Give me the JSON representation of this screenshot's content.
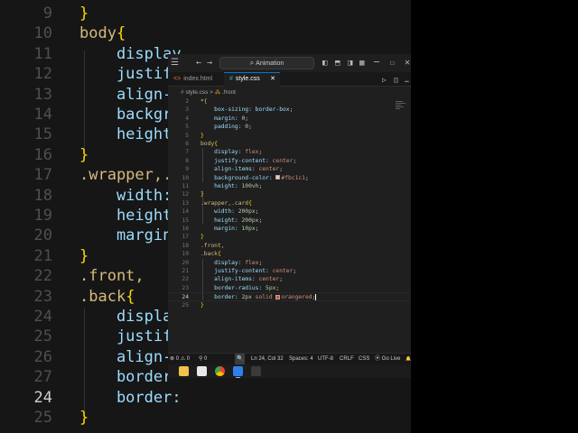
{
  "background_editor": {
    "lines": [
      {
        "num": "9",
        "code": [
          {
            "t": "}",
            "c": "brace"
          }
        ],
        "active": false
      },
      {
        "num": "10",
        "code": [
          {
            "t": "body",
            "c": "sel"
          },
          {
            "t": "{",
            "c": "brace"
          }
        ],
        "active": false
      },
      {
        "num": "11",
        "code": [
          {
            "t": "    display",
            "c": "prop"
          }
        ],
        "active": false
      },
      {
        "num": "12",
        "code": [
          {
            "t": "    justify",
            "c": "prop"
          }
        ],
        "active": false
      },
      {
        "num": "13",
        "code": [
          {
            "t": "    align-i",
            "c": "prop"
          }
        ],
        "active": false
      },
      {
        "num": "14",
        "code": [
          {
            "t": "    backgro",
            "c": "prop"
          }
        ],
        "active": false
      },
      {
        "num": "15",
        "code": [
          {
            "t": "    height:",
            "c": "prop"
          }
        ],
        "active": false
      },
      {
        "num": "16",
        "code": [
          {
            "t": "}",
            "c": "brace"
          }
        ],
        "active": false
      },
      {
        "num": "17",
        "code": [
          {
            "t": ".wrapper,.c",
            "c": "sel"
          }
        ],
        "active": false
      },
      {
        "num": "18",
        "code": [
          {
            "t": "    width:",
            "c": "prop"
          }
        ],
        "active": false
      },
      {
        "num": "19",
        "code": [
          {
            "t": "    height:",
            "c": "prop"
          }
        ],
        "active": false
      },
      {
        "num": "20",
        "code": [
          {
            "t": "    margin:",
            "c": "prop"
          }
        ],
        "active": false
      },
      {
        "num": "21",
        "code": [
          {
            "t": "}",
            "c": "brace"
          }
        ],
        "active": false
      },
      {
        "num": "22",
        "code": [
          {
            "t": ".front,",
            "c": "sel"
          }
        ],
        "active": false
      },
      {
        "num": "23",
        "code": [
          {
            "t": ".back",
            "c": "sel"
          },
          {
            "t": "{",
            "c": "brace"
          }
        ],
        "active": false
      },
      {
        "num": "24",
        "code": [
          {
            "t": "    display",
            "c": "prop"
          }
        ],
        "active": false
      },
      {
        "num": "25",
        "code": [
          {
            "t": "    justify",
            "c": "prop"
          }
        ],
        "active": false
      },
      {
        "num": "26",
        "code": [
          {
            "t": "    align-i",
            "c": "prop"
          }
        ],
        "active": false
      },
      {
        "num": "27",
        "code": [
          {
            "t": "    border-",
            "c": "prop"
          }
        ],
        "active": false
      },
      {
        "num": "24",
        "code": [
          {
            "t": "    border:",
            "c": "prop"
          }
        ],
        "active": true
      },
      {
        "num": "25",
        "code": [
          {
            "t": "}",
            "c": "brace"
          }
        ],
        "active": false
      }
    ]
  },
  "titlebar": {
    "search_text": "Animation",
    "icons": [
      "menu-icon",
      "back-arrow-icon",
      "forward-arrow-icon",
      "layout-sidebar-icon",
      "layout-panel-icon",
      "layout-split-icon",
      "customize-layout-icon",
      "minimize-icon",
      "maximize-icon",
      "close-icon"
    ]
  },
  "tabs": [
    {
      "label": "index.html",
      "icon": "<>",
      "active": false
    },
    {
      "label": "style.css",
      "icon": "#",
      "active": true,
      "close": "✕"
    }
  ],
  "breadcrumb": {
    "file": "style.css",
    "separator": ">",
    "symbol": ".front"
  },
  "code_lines": [
    {
      "num": "2",
      "segs": [
        {
          "t": "*{",
          "c": "sel"
        }
      ]
    },
    {
      "num": "3",
      "segs": [
        {
          "t": "    box-sizing: border-box;",
          "c": "prop"
        }
      ]
    },
    {
      "num": "4",
      "segs": [
        {
          "t": "    margin: ",
          "c": "prop"
        },
        {
          "t": "0",
          "c": "num"
        },
        {
          "t": ";",
          "c": "punc"
        }
      ]
    },
    {
      "num": "5",
      "segs": [
        {
          "t": "    padding: ",
          "c": "prop"
        },
        {
          "t": "0",
          "c": "num"
        },
        {
          "t": ";",
          "c": "punc"
        }
      ]
    },
    {
      "num": "5",
      "segs": [
        {
          "t": "}",
          "c": "brace"
        }
      ]
    },
    {
      "num": "6",
      "segs": [
        {
          "t": "body",
          "c": "sel"
        },
        {
          "t": "{",
          "c": "brace"
        }
      ]
    },
    {
      "num": "7",
      "segs": [
        {
          "t": "    display: ",
          "c": "prop"
        },
        {
          "t": "flex",
          "c": "val"
        },
        {
          "t": ";",
          "c": "punc"
        }
      ]
    },
    {
      "num": "8",
      "segs": [
        {
          "t": "    justify-content: ",
          "c": "prop"
        },
        {
          "t": "center",
          "c": "val"
        },
        {
          "t": ";",
          "c": "punc"
        }
      ]
    },
    {
      "num": "9",
      "segs": [
        {
          "t": "    align-items: ",
          "c": "prop"
        },
        {
          "t": "center",
          "c": "val"
        },
        {
          "t": ";",
          "c": "punc"
        }
      ]
    },
    {
      "num": "10",
      "segs": [
        {
          "t": "    background-color: ",
          "c": "prop"
        },
        {
          "swatch": "#fbc1c1"
        },
        {
          "t": "#fbc1c1",
          "c": "val"
        },
        {
          "t": ";",
          "c": "punc"
        }
      ]
    },
    {
      "num": "11",
      "segs": [
        {
          "t": "    height: ",
          "c": "prop"
        },
        {
          "t": "100vh",
          "c": "num"
        },
        {
          "t": ";",
          "c": "punc"
        }
      ]
    },
    {
      "num": "12",
      "segs": [
        {
          "t": "}",
          "c": "brace"
        }
      ]
    },
    {
      "num": "13",
      "segs": [
        {
          "t": ".wrapper,.card",
          "c": "sel"
        },
        {
          "t": "{",
          "c": "brace"
        }
      ]
    },
    {
      "num": "14",
      "segs": [
        {
          "t": "    width: ",
          "c": "prop"
        },
        {
          "t": "200px",
          "c": "num"
        },
        {
          "t": ";",
          "c": "punc"
        }
      ]
    },
    {
      "num": "15",
      "segs": [
        {
          "t": "    height: ",
          "c": "prop"
        },
        {
          "t": "200px",
          "c": "num"
        },
        {
          "t": ";",
          "c": "punc"
        }
      ]
    },
    {
      "num": "16",
      "segs": [
        {
          "t": "    margin: ",
          "c": "prop"
        },
        {
          "t": "10px",
          "c": "num"
        },
        {
          "t": ";",
          "c": "punc"
        }
      ]
    },
    {
      "num": "17",
      "segs": [
        {
          "t": "}",
          "c": "brace"
        }
      ]
    },
    {
      "num": "18",
      "segs": [
        {
          "t": ".front,",
          "c": "sel"
        }
      ]
    },
    {
      "num": "19",
      "segs": [
        {
          "t": ".back",
          "c": "sel"
        },
        {
          "t": "{",
          "c": "brace"
        }
      ]
    },
    {
      "num": "20",
      "segs": [
        {
          "t": "    display: ",
          "c": "prop"
        },
        {
          "t": "flex",
          "c": "val"
        },
        {
          "t": ";",
          "c": "punc"
        }
      ]
    },
    {
      "num": "21",
      "segs": [
        {
          "t": "    justify-content: ",
          "c": "prop"
        },
        {
          "t": "center",
          "c": "val"
        },
        {
          "t": ";",
          "c": "punc"
        }
      ]
    },
    {
      "num": "22",
      "segs": [
        {
          "t": "    align-items: ",
          "c": "prop"
        },
        {
          "t": "center",
          "c": "val"
        },
        {
          "t": ";",
          "c": "punc"
        }
      ]
    },
    {
      "num": "23",
      "segs": [
        {
          "t": "    border-radius: ",
          "c": "prop"
        },
        {
          "t": "5px",
          "c": "num"
        },
        {
          "t": ";",
          "c": "punc"
        }
      ]
    },
    {
      "num": "24",
      "current": true,
      "segs": [
        {
          "t": "    border: ",
          "c": "prop"
        },
        {
          "t": "2px",
          "c": "num"
        },
        {
          "t": " solid ",
          "c": "val"
        },
        {
          "swatch": "#ff4500"
        },
        {
          "t": "orangered",
          "c": "val"
        },
        {
          "t": ";",
          "c": "punc"
        },
        {
          "cursor": true
        }
      ]
    },
    {
      "num": "25",
      "segs": [
        {
          "t": "}",
          "c": "brace"
        }
      ]
    }
  ],
  "statusbar": {
    "problems": "⊗ 0 ⚠ 0",
    "ports": "⚲ 0",
    "zoom": "🔍",
    "position": "Ln 24, Col 32",
    "spaces": "Spaces: 4",
    "encoding": "UTF-8",
    "eol": "CRLF",
    "language": "CSS",
    "go_live": "⦿ Go Live",
    "bell": "🔔"
  },
  "taskbar": {
    "apps": [
      {
        "name": "file-explorer-icon",
        "color": "#f2c14e"
      },
      {
        "name": "notepad-icon",
        "color": "#e8e8e8"
      },
      {
        "name": "chrome-icon",
        "color": "#4caf50"
      },
      {
        "name": "vscode-icon",
        "color": "#2f80ed"
      },
      {
        "name": "terminal-icon",
        "color": "#3a3a3a"
      }
    ]
  }
}
